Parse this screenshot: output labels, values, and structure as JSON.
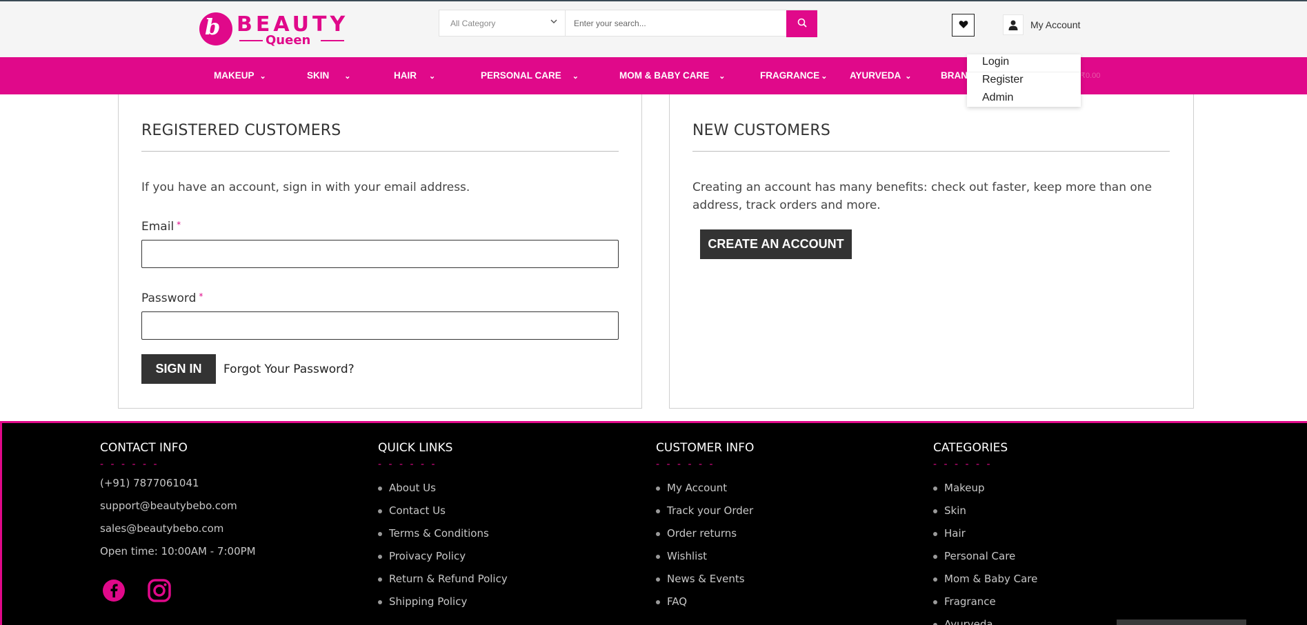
{
  "brand": {
    "logo_top": "BEAUTY",
    "logo_bottom": "Queen",
    "logo_mark": "b"
  },
  "search": {
    "category": "All Category",
    "placeholder": "Enter your search..."
  },
  "account": {
    "label": "My Account"
  },
  "nav": {
    "items": [
      {
        "label": "MAKEUP"
      },
      {
        "label": "SKIN"
      },
      {
        "label": "HAIR"
      },
      {
        "label": "PERSONAL CARE"
      },
      {
        "label": "MOM & BABY CARE"
      },
      {
        "label": "FRAGRANCE"
      },
      {
        "label": "AYURVEDA"
      },
      {
        "label": "BRAN"
      }
    ],
    "cart_amount": "₹0.00"
  },
  "account_menu": {
    "items": [
      {
        "label": "Login"
      },
      {
        "label": "Register"
      },
      {
        "label": "Admin"
      }
    ]
  },
  "registered": {
    "title": "REGISTERED CUSTOMERS",
    "intro": "If you have an account, sign in with your email address.",
    "email_label": "Email",
    "password_label": "Password",
    "required_mark": "*",
    "signin_label": "SIGN IN",
    "forgot_label": "Forgot Your Password?"
  },
  "new_customers": {
    "title": "NEW CUSTOMERS",
    "text": "Creating an account has many benefits: check out faster, keep more than one address, track orders and more.",
    "create_label": "CREATE AN ACCOUNT"
  },
  "footer": {
    "dash": "- - - - - -",
    "contact": {
      "title": "CONTACT INFO",
      "lines": [
        "(+91) 7877061041",
        "support@beautybebo.com",
        "sales@beautybebo.com",
        "Open time: 10:00AM - 7:00PM"
      ]
    },
    "quick_links": {
      "title": "QUICK LINKS",
      "items": [
        "About Us",
        "Contact Us",
        "Terms & Conditions",
        "Proivacy Policy",
        "Return & Refund Policy",
        "Shipping Policy"
      ]
    },
    "customer_info": {
      "title": "CUSTOMER INFO",
      "items": [
        "My Account",
        "Track your Order",
        "Order returns",
        "Wishlist",
        "News & Events",
        "FAQ"
      ]
    },
    "categories": {
      "title": "CATEGORIES",
      "items": [
        "Makeup",
        "Skin",
        "Hair",
        "Personal Care",
        "Mom & Baby Care",
        "Fragrance",
        "Ayurveda"
      ]
    },
    "social": [
      {
        "icon": "facebook-icon"
      },
      {
        "icon": "instagram-icon"
      }
    ]
  },
  "colors": {
    "brand_pink": "#e0098a",
    "dark_button": "#333333",
    "footer_bg": "#000000"
  }
}
